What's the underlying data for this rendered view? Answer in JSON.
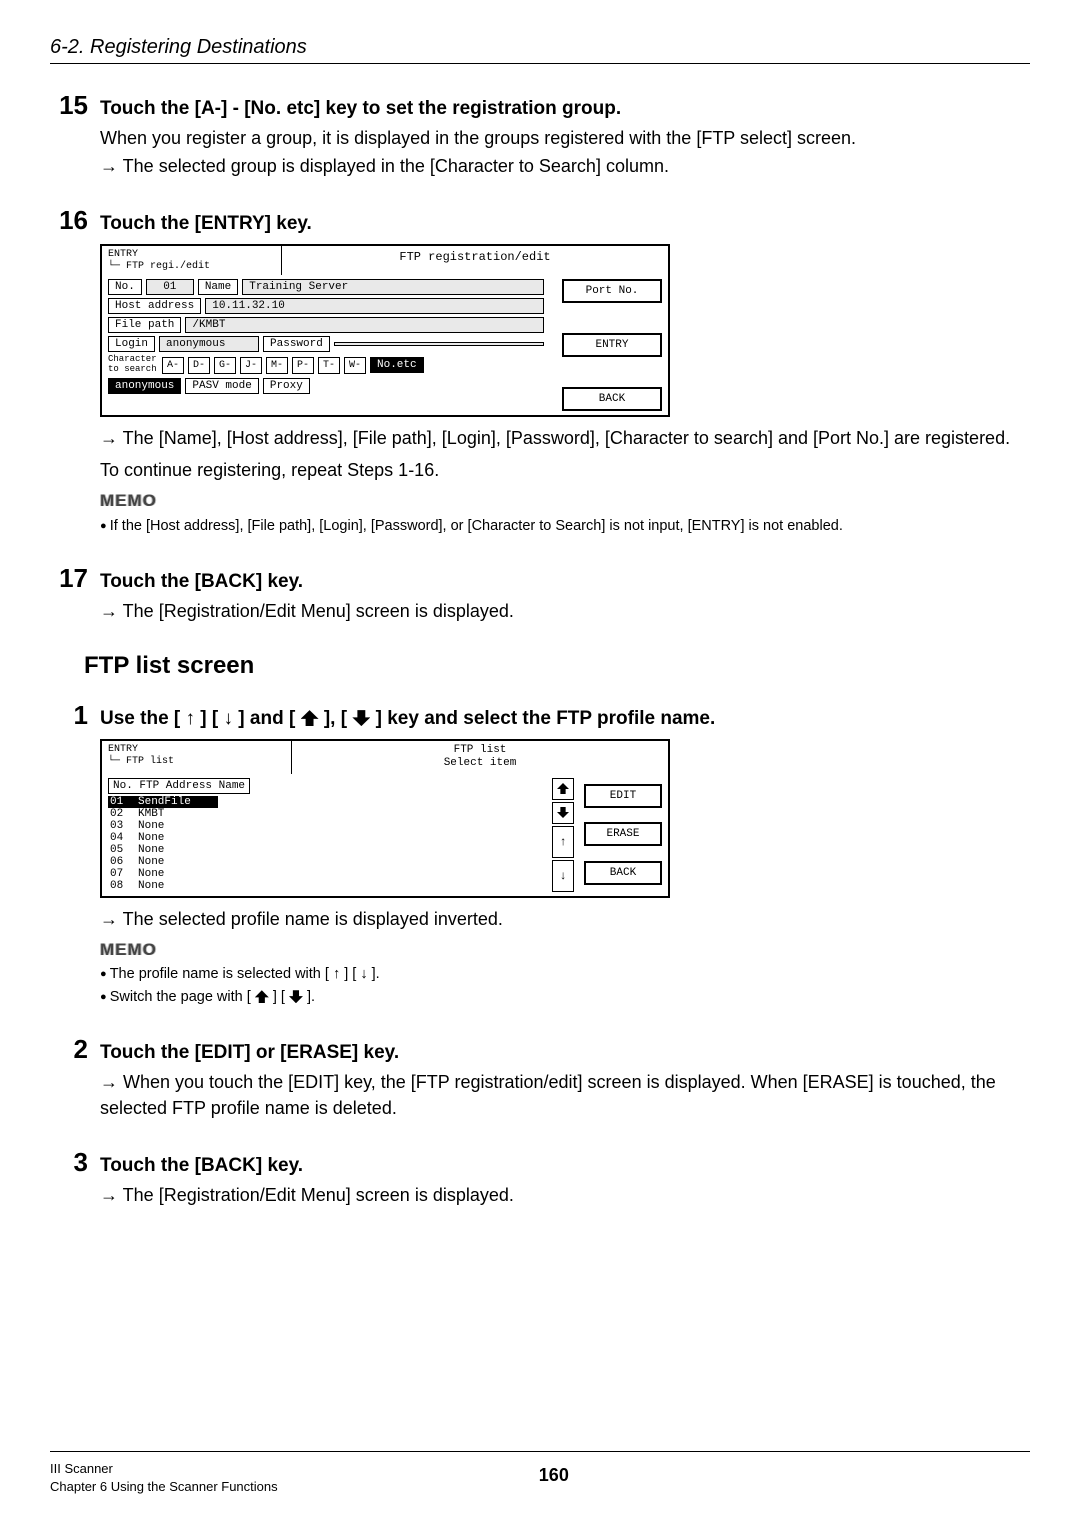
{
  "header": {
    "section": "6-2. Registering Destinations"
  },
  "steps": {
    "s15": {
      "num": "15",
      "title": "Touch the [A-] - [No. etc] key to set the registration group.",
      "line1": "When you register a group, it is displayed in the groups registered with the [FTP select] screen.",
      "line2": "→ The selected group is displayed in the [Character to Search] column."
    },
    "s16": {
      "num": "16",
      "title": "Touch the [ENTRY] key.",
      "result1": "→ The [Name], [Host address], [File path], [Login], [Password], [Character to search] and [Port No.] are registered.",
      "result2": "To continue registering, repeat Steps 1-16.",
      "memo_label": "MEMO",
      "memo1": "If the [Host address], [File path], [Login], [Password], or [Character to Search] is not input, [ENTRY] is not enabled."
    },
    "s17": {
      "num": "17",
      "title": "Touch the [BACK] key.",
      "result": "→ The [Registration/Edit Menu] screen is displayed."
    }
  },
  "lcd1": {
    "breadcrumb1": "ENTRY",
    "breadcrumb2": "└─ FTP regi./edit",
    "title": "FTP registration/edit",
    "no_label": "No.",
    "no_value": "01",
    "name_label": "Name",
    "name_value": "Training Server",
    "port_label": "Port No.",
    "host_label": "Host address",
    "host_value": "10.11.32.10",
    "filepath_label": "File path",
    "filepath_value": "/KMBT",
    "entry_btn": "ENTRY",
    "login_label": "Login",
    "login_value": "anonymous",
    "password_label": "Password",
    "password_value": "",
    "char_label": "Character\nto search",
    "chars": [
      "A-",
      "D-",
      "G-",
      "J-",
      "M-",
      "P-",
      "T-",
      "W-"
    ],
    "noetc": "No.etc",
    "anonymous": "anonymous",
    "pasv": "PASV mode",
    "proxy": "Proxy",
    "back_btn": "BACK"
  },
  "ftp_list_heading": "FTP list screen",
  "steps2": {
    "s1": {
      "num": "1",
      "title_pre": "Use the [ ↑ ] [ ↓ ] and [",
      "title_mid": "], [",
      "title_post": "] key and select the FTP profile name.",
      "result": "→ The selected profile name is displayed inverted.",
      "memo_label": "MEMO",
      "memo1": "The profile name is selected with [ ↑ ] [ ↓ ].",
      "memo2_pre": "Switch the page with [",
      "memo2_mid": "] [",
      "memo2_post": "]."
    },
    "s2": {
      "num": "2",
      "title": "Touch the [EDIT] or [ERASE] key.",
      "result": "→ When you touch the [EDIT] key, the [FTP registration/edit] screen is displayed. When [ERASE] is touched, the selected FTP profile name is deleted."
    },
    "s3": {
      "num": "3",
      "title": "Touch the [BACK] key.",
      "result": "→ The [Registration/Edit Menu] screen is displayed."
    }
  },
  "lcd2": {
    "breadcrumb1": "ENTRY",
    "breadcrumb2": "└─ FTP list",
    "title1": "FTP list",
    "title2": "Select item",
    "list_header": "No.  FTP Address Name",
    "rows": [
      {
        "no": "01",
        "name": "SendFile",
        "sel": true
      },
      {
        "no": "02",
        "name": "KMBT"
      },
      {
        "no": "03",
        "name": "None"
      },
      {
        "no": "04",
        "name": "None"
      },
      {
        "no": "05",
        "name": "None"
      },
      {
        "no": "06",
        "name": "None"
      },
      {
        "no": "07",
        "name": "None"
      },
      {
        "no": "08",
        "name": "None"
      }
    ],
    "edit": "EDIT",
    "erase": "ERASE",
    "back": "BACK",
    "up": "↑",
    "down": "↓"
  },
  "footer": {
    "left1": "III Scanner",
    "left2": "Chapter 6 Using the Scanner Functions",
    "page": "160"
  }
}
